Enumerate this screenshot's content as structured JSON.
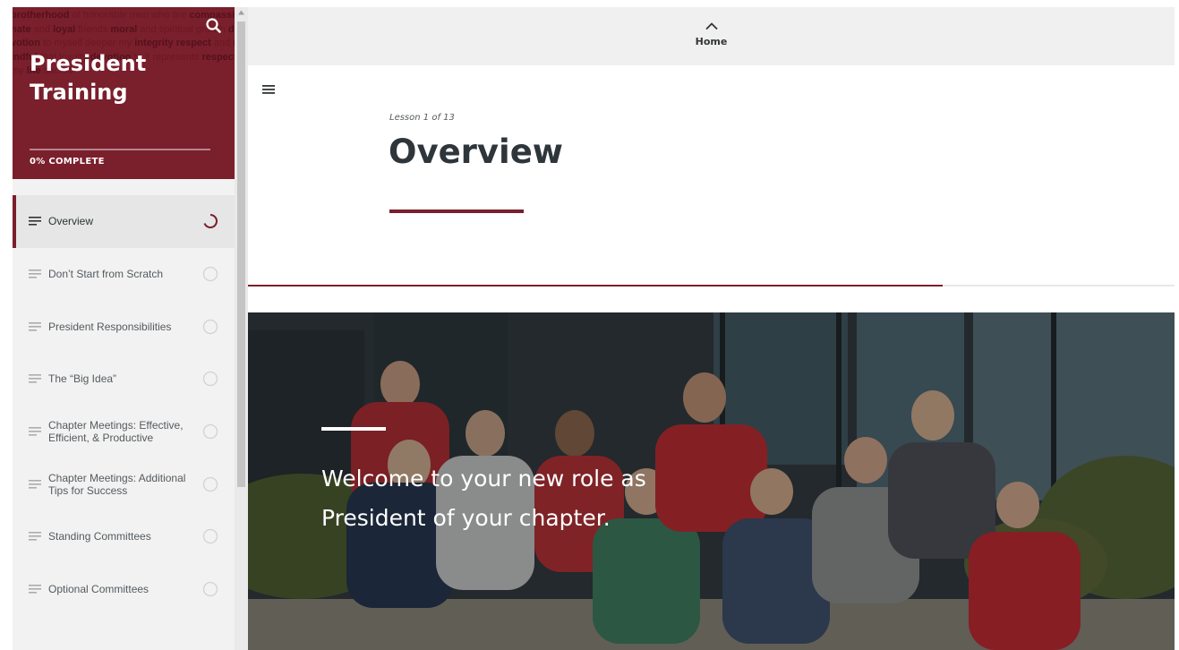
{
  "sidebar": {
    "course_title": "President Training",
    "progress_text": "0% COMPLETE",
    "progress_percent": 0,
    "background_text_words": [
      "brotherhood",
      "of",
      "honorable",
      "men",
      "who",
      "are",
      "compassionate",
      "and",
      "loyal",
      "friends",
      "moral",
      "and",
      "spiritual",
      "growth",
      "devotion",
      "to",
      "myself",
      "deeper",
      "my",
      "integrity",
      "respect",
      "and",
      "mindful",
      "that",
      "loyalty",
      "devotion",
      "to",
      "it",
      "represents",
      "respect",
      "my",
      "life",
      "sacred"
    ],
    "lessons": [
      {
        "label": "Overview",
        "status": "in-progress",
        "active": true
      },
      {
        "label": "Don’t Start from Scratch",
        "status": "not-started",
        "active": false
      },
      {
        "label": "President Responsibilities",
        "status": "not-started",
        "active": false
      },
      {
        "label": "The “Big Idea”",
        "status": "not-started",
        "active": false
      },
      {
        "label": "Chapter Meetings: Effective, Efficient, & Productive",
        "status": "not-started",
        "active": false
      },
      {
        "label": "Chapter Meetings: Additional Tips for Success",
        "status": "not-started",
        "active": false
      },
      {
        "label": "Standing Committees",
        "status": "not-started",
        "active": false
      },
      {
        "label": "Optional Committees",
        "status": "not-started",
        "active": false
      }
    ]
  },
  "main": {
    "home_label": "Home",
    "lesson_count": "Lesson 1 of 13",
    "lesson_title": "Overview",
    "scroll_progress_percent": 75,
    "hero_text": "Welcome to your new role as President of your chapter."
  },
  "colors": {
    "accent": "#7a1f2c",
    "sidebar_bg": "#f2f2f2",
    "topbar_bg": "#f0f0f0"
  },
  "icons": {
    "search": "search-icon",
    "menu": "hamburger-menu-icon",
    "home": "chevron-up-icon",
    "lesson": "lesson-lines-icon",
    "status_in_progress": "progress-ring-icon",
    "status_not_started": "empty-circle-icon"
  }
}
